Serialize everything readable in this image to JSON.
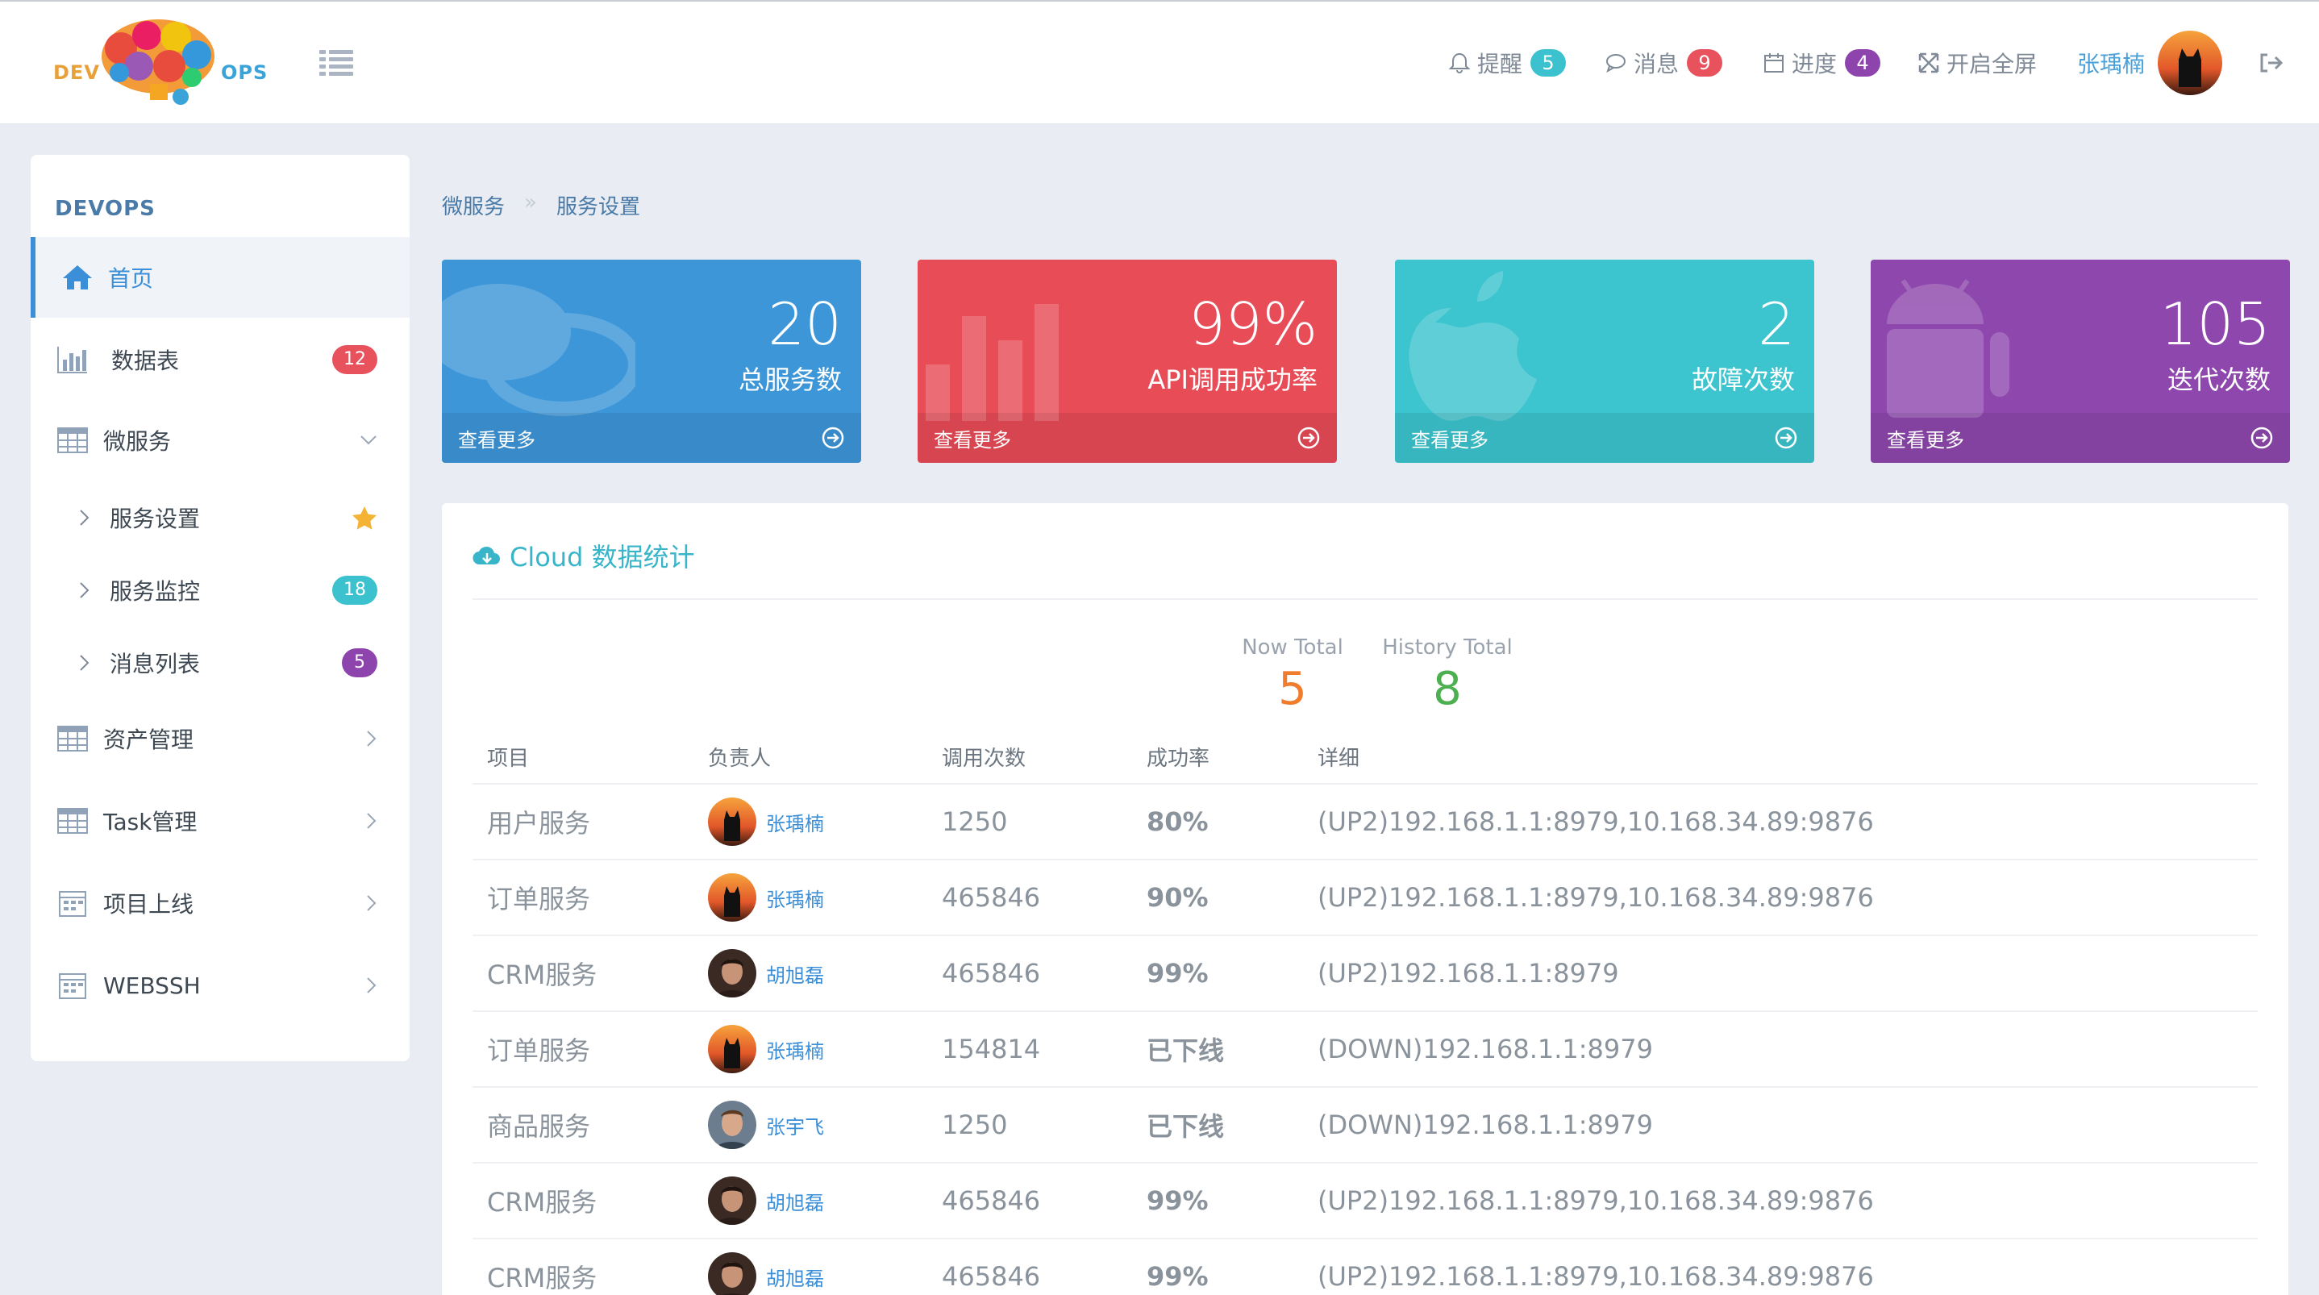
{
  "brand": {
    "left": "DEV",
    "right": "OPS"
  },
  "topnav": {
    "remind": {
      "label": "提醒",
      "count": "5",
      "color": "#3cc1cf"
    },
    "message": {
      "label": "消息",
      "count": "9",
      "color": "#e8525d"
    },
    "progress": {
      "label": "进度",
      "count": "4",
      "color": "#8e44ad"
    },
    "fullscreen": {
      "label": "开启全屏"
    },
    "user": "张瑀楠"
  },
  "sidebar": {
    "title": "DEVOPS",
    "items": [
      {
        "label": "首页",
        "icon": "home-icon"
      },
      {
        "label": "数据表",
        "icon": "bar-chart-icon",
        "badge": "12",
        "badge_color": "#e8525d"
      },
      {
        "label": "微服务",
        "icon": "grid-icon"
      },
      {
        "label": "服务设置",
        "icon": "chevron-right-icon",
        "badge_icon": "star-icon"
      },
      {
        "label": "服务监控",
        "icon": "chevron-right-icon",
        "badge": "18",
        "badge_color": "#3cc1cf"
      },
      {
        "label": "消息列表",
        "icon": "chevron-right-icon",
        "badge": "5",
        "badge_color": "#8e44ad"
      },
      {
        "label": "资产管理",
        "icon": "grid-icon"
      },
      {
        "label": "Task管理",
        "icon": "grid-icon"
      },
      {
        "label": "项目上线",
        "icon": "calendar-icon"
      },
      {
        "label": "WEBSSH",
        "icon": "calendar-icon"
      }
    ]
  },
  "breadcrumb": {
    "root": "微服务",
    "sep": "»",
    "current": "服务设置"
  },
  "stats": [
    {
      "value": "20",
      "label": "总服务数",
      "more": "查看更多",
      "color": "#3d96d8",
      "icon": "chat-bubble-icon"
    },
    {
      "value": "99%",
      "label": "API调用成功率",
      "more": "查看更多",
      "color": "#e84c57",
      "icon": "bar-chart-icon"
    },
    {
      "value": "2",
      "label": "故障次数",
      "more": "查看更多",
      "color": "#3cc4cf",
      "icon": "apple-icon"
    },
    {
      "value": "105",
      "label": "迭代次数",
      "more": "查看更多",
      "color": "#8e48ad",
      "icon": "android-icon"
    }
  ],
  "panel": {
    "title": "Cloud 数据统计",
    "now_total_label": "Now Total",
    "now_total": "5",
    "history_total_label": "History Total",
    "history_total": "8"
  },
  "table": {
    "headers": [
      "项目",
      "负责人",
      "调用次数",
      "成功率",
      "详细"
    ],
    "rows": [
      {
        "project": "用户服务",
        "owner": "张瑀楠",
        "avatar": "cat",
        "calls": "1250",
        "rate": "80%",
        "detail": "(UP2)192.168.1.1:8979,10.168.34.89:9876"
      },
      {
        "project": "订单服务",
        "owner": "张瑀楠",
        "avatar": "cat",
        "calls": "465846",
        "rate": "90%",
        "detail": "(UP2)192.168.1.1:8979,10.168.34.89:9876"
      },
      {
        "project": "CRM服务",
        "owner": "胡旭磊",
        "avatar": "person1",
        "calls": "465846",
        "rate": "99%",
        "detail": "(UP2)192.168.1.1:8979"
      },
      {
        "project": "订单服务",
        "owner": "张瑀楠",
        "avatar": "cat",
        "calls": "154814",
        "rate": "已下线",
        "detail": "(DOWN)192.168.1.1:8979"
      },
      {
        "project": "商品服务",
        "owner": "张宇飞",
        "avatar": "person2",
        "calls": "1250",
        "rate": "已下线",
        "detail": "(DOWN)192.168.1.1:8979"
      },
      {
        "project": "CRM服务",
        "owner": "胡旭磊",
        "avatar": "person1",
        "calls": "465846",
        "rate": "99%",
        "detail": "(UP2)192.168.1.1:8979,10.168.34.89:9876"
      },
      {
        "project": "CRM服务",
        "owner": "胡旭磊",
        "avatar": "person1",
        "calls": "465846",
        "rate": "99%",
        "detail": "(UP2)192.168.1.1:8979,10.168.34.89:9876"
      }
    ]
  }
}
